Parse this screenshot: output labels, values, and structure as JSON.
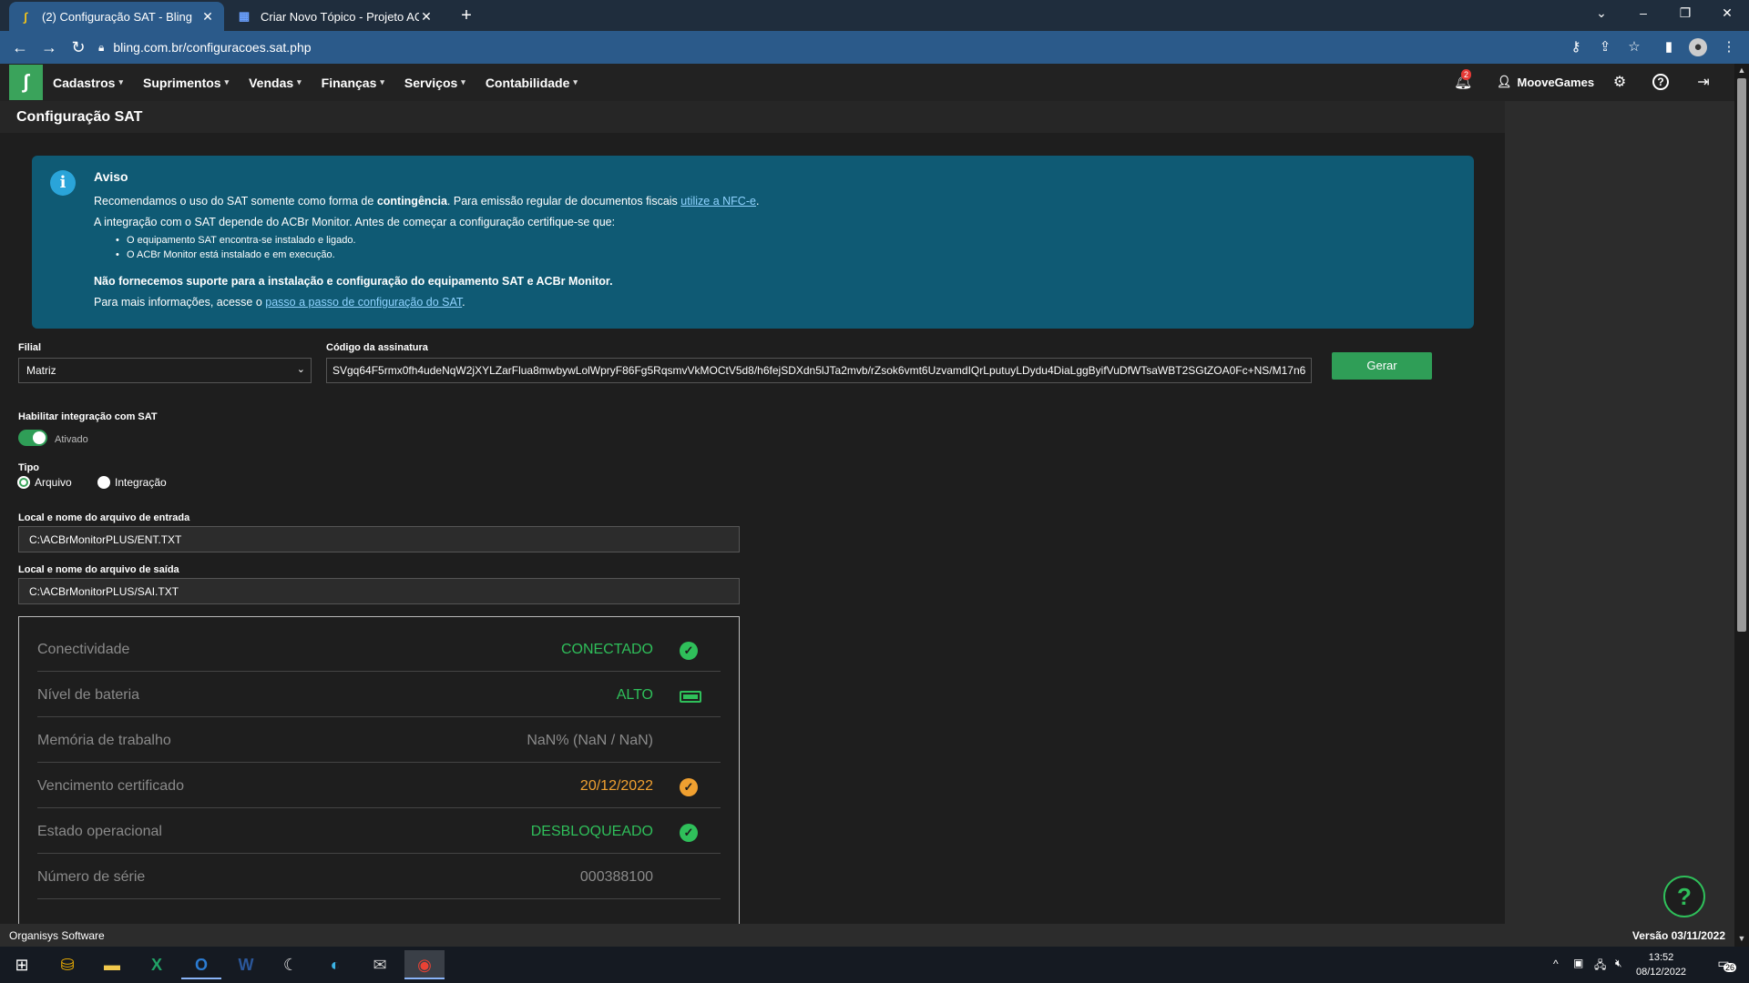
{
  "browser": {
    "tabs": [
      {
        "title": "(2) Configuração SAT - Bling",
        "favicon": "bling-icon"
      },
      {
        "title": "Criar Novo Tópico - Projeto ACBr",
        "favicon": "acbr-icon"
      }
    ],
    "url": "bling.com.br/configuracoes.sat.php"
  },
  "nav": {
    "menu": [
      "Cadastros",
      "Suprimentos",
      "Vendas",
      "Finanças",
      "Serviços",
      "Contabilidade"
    ],
    "notifications_count": "2",
    "user": "MooveGames"
  },
  "page": {
    "title": "Configuração SAT"
  },
  "alert": {
    "title": "Aviso",
    "line1_pre": "Recomendamos o uso do SAT somente como forma de ",
    "line1_bold": "contingência",
    "line1_post": ". Para emissão regular de documentos fiscais ",
    "line1_link": "utilize a NFC-e",
    "line2": "A integração com o SAT depende do ACBr Monitor. Antes de começar a configuração certifique-se que:",
    "bullets": [
      "O equipamento SAT encontra-se instalado e ligado.",
      "O ACBr Monitor está instalado e em execução."
    ],
    "line3": "Não fornecemos suporte para a instalação e configuração do equipamento SAT e ACBr Monitor.",
    "line4_pre": "Para mais informações, acesse o ",
    "line4_link": "passo a passo de configuração do SAT"
  },
  "form": {
    "filial_label": "Filial",
    "filial_value": "Matriz",
    "signature_label": "Código da assinatura",
    "signature_value": "SVgq64F5rmx0fh4udeNqW2jXYLZarFlua8mwbywLolWpryF86Fg5RqsmvVkMOCtV5d8/h6fejSDXdn5lJTa2mvb/rZsok6vmt6UzvamdIQrLputuyLDydu4DiaLggByifVuDfWTsaWBT2SGtZOA0Fc+NS/M17n6",
    "gerar_label": "Gerar",
    "habilitar_label": "Habilitar integração com SAT",
    "habilitar_state": "Ativado",
    "tipo_label": "Tipo",
    "tipo_options": [
      "Arquivo",
      "Integração"
    ],
    "entrada_label": "Local e nome do arquivo de entrada",
    "entrada_value": "C:\\ACBrMonitorPLUS/ENT.TXT",
    "saida_label": "Local e nome do arquivo de saída",
    "saida_value": "C:\\ACBrMonitorPLUS/SAI.TXT"
  },
  "status": [
    {
      "label": "Conectividade",
      "value": "CONECTADO",
      "color": "#2fbf5a",
      "icon": "check-circle-icon"
    },
    {
      "label": "Nível de bateria",
      "value": "ALTO",
      "color": "#2fbf5a",
      "icon": "battery-full-icon"
    },
    {
      "label": "Memória de trabalho",
      "value": "NaN% (NaN / NaN)",
      "color": "#8a8a8a",
      "icon": ""
    },
    {
      "label": "Vencimento certificado",
      "value": "20/12/2022",
      "color": "#f0a030",
      "icon": "check-circle-icon"
    },
    {
      "label": "Estado operacional",
      "value": "DESBLOQUEADO",
      "color": "#2fbf5a",
      "icon": "check-circle-icon"
    },
    {
      "label": "Número de série",
      "value": "000388100",
      "color": "#8a8a8a",
      "icon": ""
    }
  ],
  "footer": {
    "left": "Organisys Software",
    "right": "Versão 03/11/2022"
  },
  "taskbar": {
    "time": "13:52",
    "date": "08/12/2022",
    "notif_count": "26"
  }
}
